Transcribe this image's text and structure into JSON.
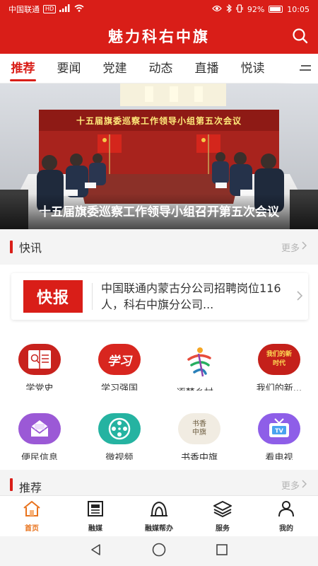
{
  "status_bar": {
    "carrier": "中国联通",
    "hd_badge": "HD",
    "battery": "92%",
    "battery_level": 0.92,
    "time": "10:05"
  },
  "header": {
    "title": "魅力科右中旗"
  },
  "tabs": [
    {
      "label": "推荐",
      "active": true
    },
    {
      "label": "要闻",
      "active": false
    },
    {
      "label": "党建",
      "active": false
    },
    {
      "label": "动态",
      "active": false
    },
    {
      "label": "直播",
      "active": false
    },
    {
      "label": "悦读",
      "active": false
    }
  ],
  "banner": {
    "sign_text": "十五届旗委巡察工作领导小组第五次会议",
    "caption": "十五届旗委巡察工作领导小组召开第五次会议"
  },
  "news_section": {
    "title": "快讯",
    "more_label": "更多"
  },
  "news_card": {
    "badge": "快报",
    "text": "中国联通内蒙古分公司招聘岗位116人，科右中旗分公司..."
  },
  "grid": [
    {
      "label": "学党史",
      "icon": "book-icon"
    },
    {
      "label": "学习强国",
      "icon": "xuexi-icon"
    },
    {
      "label": "逐梦乡村...",
      "icon": "dream-village-icon"
    },
    {
      "label": "我们的新...",
      "icon": "new-era-icon"
    },
    {
      "label": "便民信息",
      "icon": "mail-icon"
    },
    {
      "label": "微视频",
      "icon": "film-reel-icon"
    },
    {
      "label": "书香中旗",
      "icon": "book-scent-icon"
    },
    {
      "label": "看电视",
      "icon": "tv-icon"
    }
  ],
  "grid_book_scent_text": "书香中旗",
  "grid_new_era_text": "我们的新时代",
  "grid_xuexi_text": "学习",
  "recommend_section": {
    "title": "推荐",
    "more_label": "更多"
  },
  "bottom_nav": [
    {
      "label": "首页",
      "icon": "home-icon",
      "active": true
    },
    {
      "label": "融媒",
      "icon": "newspaper-icon",
      "active": false
    },
    {
      "label": "融媒帮办",
      "icon": "help-tent-icon",
      "active": false
    },
    {
      "label": "服务",
      "icon": "layers-icon",
      "active": false
    },
    {
      "label": "我的",
      "icon": "user-icon",
      "active": false
    }
  ],
  "colors": {
    "brand_red": "#d91e18",
    "nav_active": "#e8721c",
    "text": "#333333",
    "muted": "#b5b5b5"
  }
}
